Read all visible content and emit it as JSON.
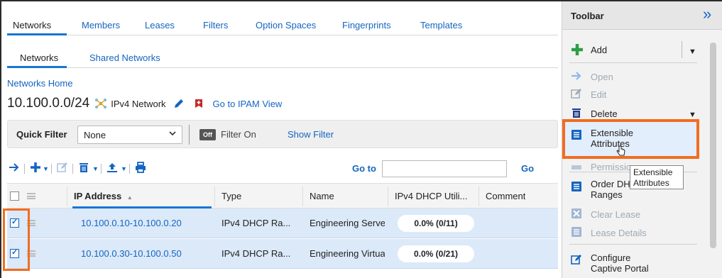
{
  "tabs": [
    "Networks",
    "Members",
    "Leases",
    "Filters",
    "Option Spaces",
    "Fingerprints",
    "Templates"
  ],
  "subtabs": [
    "Networks",
    "Shared Networks"
  ],
  "breadcrumb": "Networks Home",
  "network": {
    "cidr": "10.100.0.0/24",
    "type_label": "IPv4 Network",
    "ipam_link": "Go to IPAM View"
  },
  "quick_filter": {
    "label": "Quick Filter",
    "value": "None",
    "toggle": "Off",
    "toggle_label": "Filter On",
    "show_filter": "Show Filter"
  },
  "toolbar": {
    "goto_label": "Go to",
    "goto_placeholder": "",
    "goto_button": "Go"
  },
  "grid": {
    "columns": [
      "IP Address",
      "Type",
      "Name",
      "IPv4 DHCP Utili...",
      "Comment"
    ],
    "sort_indicator": "▲",
    "rows": [
      {
        "ip": "10.100.0.10-10.100.0.20",
        "type": "IPv4 DHCP Ra...",
        "name": "Engineering Server",
        "util": "0.0% (0/11)",
        "comment": "",
        "checked": true
      },
      {
        "ip": "10.100.0.30-10.100.0.50",
        "type": "IPv4 DHCP Ra...",
        "name": "Engineering Virtual",
        "util": "0.0% (0/21)",
        "comment": "",
        "checked": true
      }
    ]
  },
  "side_toolbar": {
    "title": "Toolbar",
    "items": {
      "add": "Add",
      "open": "Open",
      "edit": "Edit",
      "delete": "Delete",
      "extensible_1": "Extensible",
      "extensible_2": "Attributes",
      "permissions": "Permissions",
      "order_1": "Order DHCP",
      "order_2": "Ranges",
      "clear_lease": "Clear Lease",
      "lease_details": "Lease Details",
      "captive_1": "Configure",
      "captive_2": "Captive Portal"
    },
    "tooltip_1": "Extensible",
    "tooltip_2": "Attributes"
  },
  "colors": {
    "accent": "#1565c0",
    "highlight": "#f26d21",
    "row_selected": "#dbe9f9",
    "add_green": "#2e9e44",
    "delete_blue": "#1e3a8a",
    "ipam_red": "#c62828"
  },
  "icons": {
    "subnet": "subnet-icon",
    "edit": "pencil-icon",
    "bookmark": "bookmark-icon",
    "collapse": "double-chevron-right-icon"
  }
}
